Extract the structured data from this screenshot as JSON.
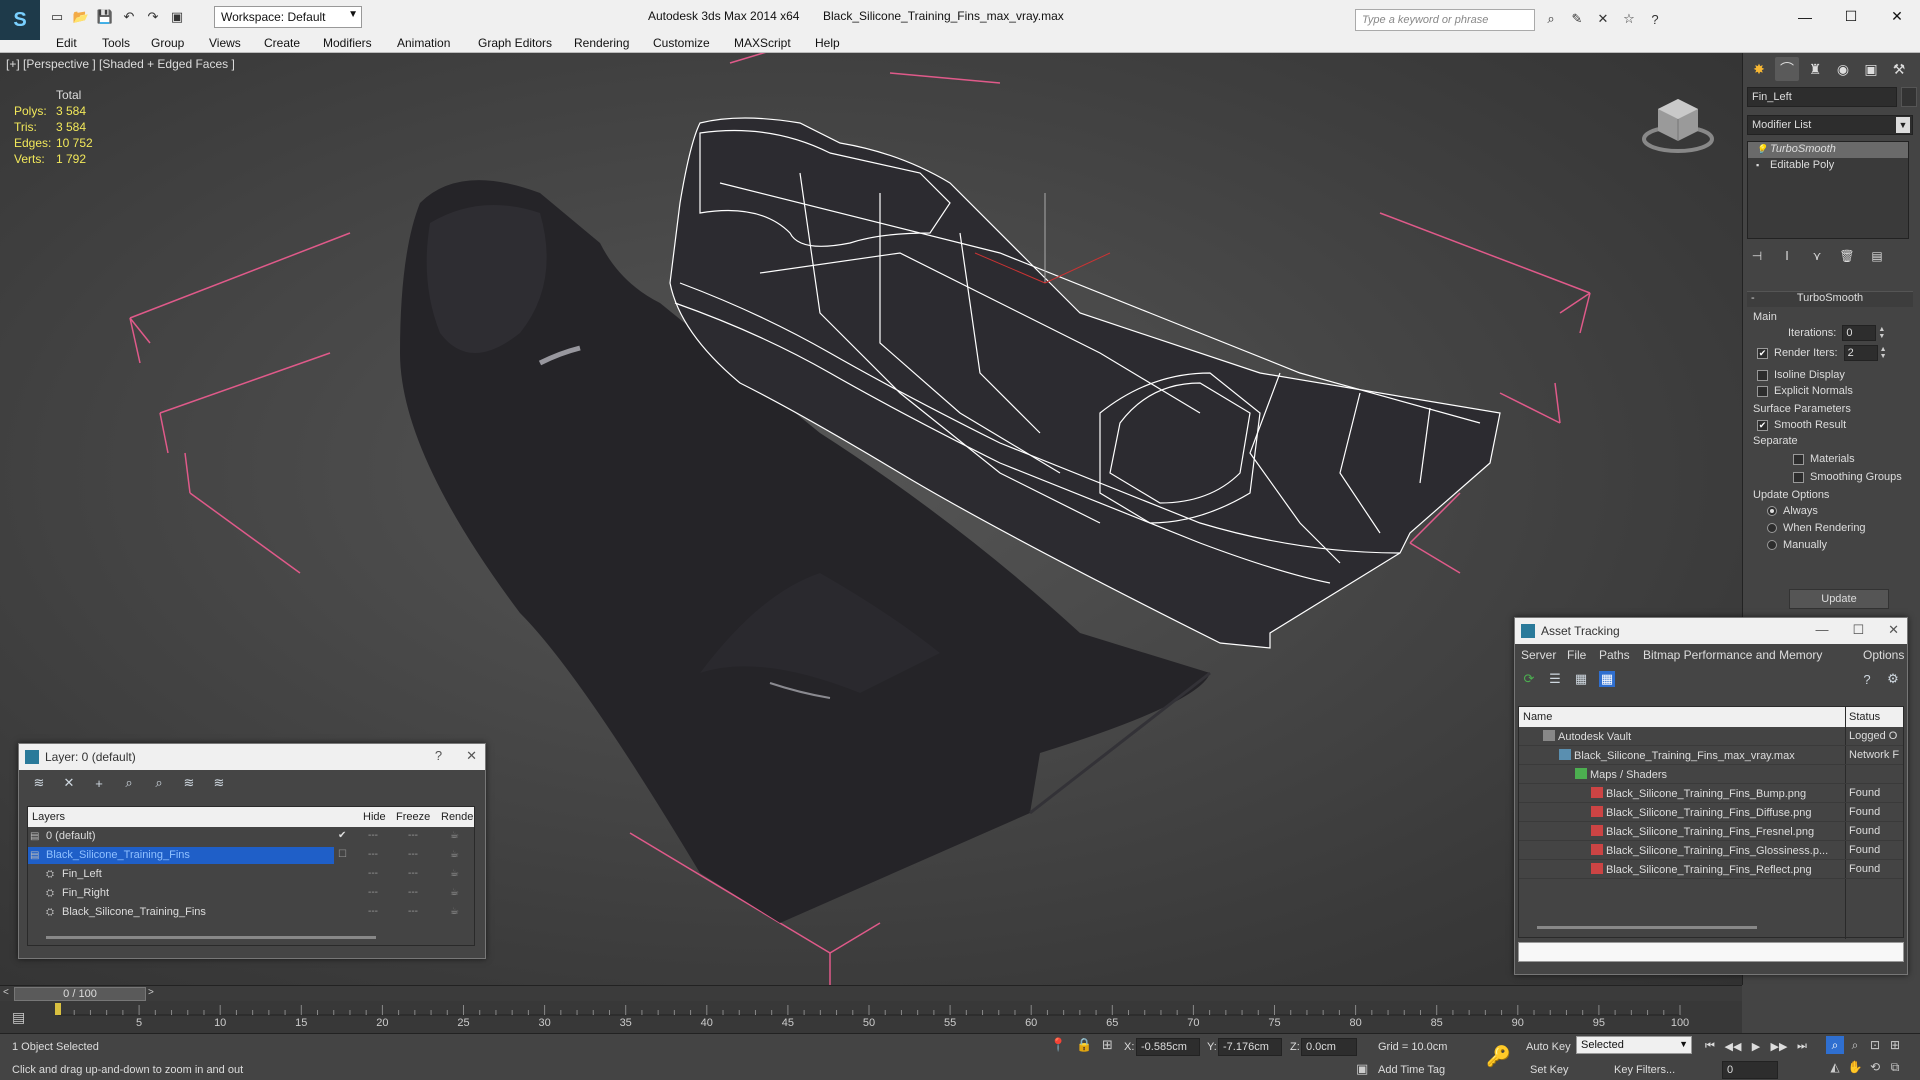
{
  "titlebar": {
    "logo": "S",
    "workspace": "Workspace: Default",
    "app_title": "Autodesk 3ds Max  2014 x64",
    "file_title": "Black_Silicone_Training_Fins_max_vray.max",
    "search_placeholder": "Type a keyword or phrase"
  },
  "menu": [
    "Edit",
    "Tools",
    "Group",
    "Views",
    "Create",
    "Modifiers",
    "Animation",
    "Graph Editors",
    "Rendering",
    "Customize",
    "MAXScript",
    "Help"
  ],
  "viewport": {
    "label": "[+] [Perspective ] [Shaded + Edged Faces ]",
    "stats": {
      "total_label": "Total",
      "rows": [
        {
          "k": "Polys:",
          "v": "3 584"
        },
        {
          "k": "Tris:",
          "v": "3 584"
        },
        {
          "k": "Edges:",
          "v": "10 752"
        },
        {
          "k": "Verts:",
          "v": "1 792"
        }
      ]
    }
  },
  "command_panel": {
    "object_name": "Fin_Left",
    "modifier_list": "Modifier List",
    "stack": [
      {
        "label": "TurboSmooth",
        "selected": true
      },
      {
        "label": "Editable Poly",
        "selected": false
      }
    ],
    "rollout_title": "TurboSmooth",
    "main_label": "Main",
    "iterations_label": "Iterations:",
    "iterations_value": "0",
    "render_iters_label": "Render Iters:",
    "render_iters_value": "2",
    "isoline_label": "Isoline Display",
    "explicit_normals_label": "Explicit Normals",
    "surface_params_label": "Surface Parameters",
    "smooth_result_label": "Smooth Result",
    "separate_label": "Separate",
    "materials_label": "Materials",
    "smoothing_groups_label": "Smoothing Groups",
    "update_options_label": "Update Options",
    "always_label": "Always",
    "when_rendering_label": "When Rendering",
    "manually_label": "Manually",
    "update_button": "Update"
  },
  "layer_dialog": {
    "title": "Layer: 0 (default)",
    "help": "?",
    "columns": {
      "layers": "Layers",
      "hide": "Hide",
      "freeze": "Freeze",
      "render": "Rende"
    },
    "rows": [
      {
        "name": "0 (default)",
        "indent": 0,
        "selected": false,
        "current": true
      },
      {
        "name": "Black_Silicone_Training_Fins",
        "indent": 0,
        "selected": true,
        "current": false
      },
      {
        "name": "Fin_Left",
        "indent": 1,
        "selected": false,
        "current": false
      },
      {
        "name": "Fin_Right",
        "indent": 1,
        "selected": false,
        "current": false
      },
      {
        "name": "Black_Silicone_Training_Fins",
        "indent": 1,
        "selected": false,
        "current": false
      }
    ]
  },
  "asset_tracking": {
    "title": "Asset Tracking",
    "menu": [
      "Server",
      "File",
      "Paths",
      "Bitmap Performance and Memory",
      "Options"
    ],
    "columns": {
      "name": "Name",
      "status": "Status"
    },
    "rows": [
      {
        "name": "Autodesk Vault",
        "status": "Logged O",
        "indent": 1,
        "icon": "vault"
      },
      {
        "name": "Black_Silicone_Training_Fins_max_vray.max",
        "status": "Network F",
        "indent": 2,
        "icon": "max"
      },
      {
        "name": "Maps / Shaders",
        "status": "",
        "indent": 3,
        "icon": "maps"
      },
      {
        "name": "Black_Silicone_Training_Fins_Bump.png",
        "status": "Found",
        "indent": 4,
        "icon": "png"
      },
      {
        "name": "Black_Silicone_Training_Fins_Diffuse.png",
        "status": "Found",
        "indent": 4,
        "icon": "png"
      },
      {
        "name": "Black_Silicone_Training_Fins_Fresnel.png",
        "status": "Found",
        "indent": 4,
        "icon": "png"
      },
      {
        "name": "Black_Silicone_Training_Fins_Glossiness.p...",
        "status": "Found",
        "indent": 4,
        "icon": "png"
      },
      {
        "name": "Black_Silicone_Training_Fins_Reflect.png",
        "status": "Found",
        "indent": 4,
        "icon": "png"
      }
    ]
  },
  "timeline": {
    "frame": "0 / 100",
    "ticks": [
      "5",
      "10",
      "15",
      "20",
      "25",
      "30",
      "35",
      "40",
      "45",
      "50",
      "55",
      "60",
      "65",
      "70",
      "75",
      "80",
      "85",
      "90",
      "95",
      "100"
    ]
  },
  "status": {
    "selection": "1 Object Selected",
    "prompt": "Click and drag up-and-down to zoom in and out",
    "x_label": "X:",
    "x_value": "-0.585cm",
    "y_label": "Y:",
    "y_value": "-7.176cm",
    "z_label": "Z:",
    "z_value": "0.0cm",
    "grid": "Grid = 10.0cm",
    "auto_key": "Auto Key",
    "set_key": "Set Key",
    "selected_dropdown": "Selected",
    "key_filters": "Key Filters...",
    "add_time_tag": "Add Time Tag",
    "frame_field": "0"
  },
  "colors": {
    "selection_blue": "#1f5fc8",
    "stats_yellow": "#f2e85a",
    "bbox_pink": "#e05a8a"
  }
}
